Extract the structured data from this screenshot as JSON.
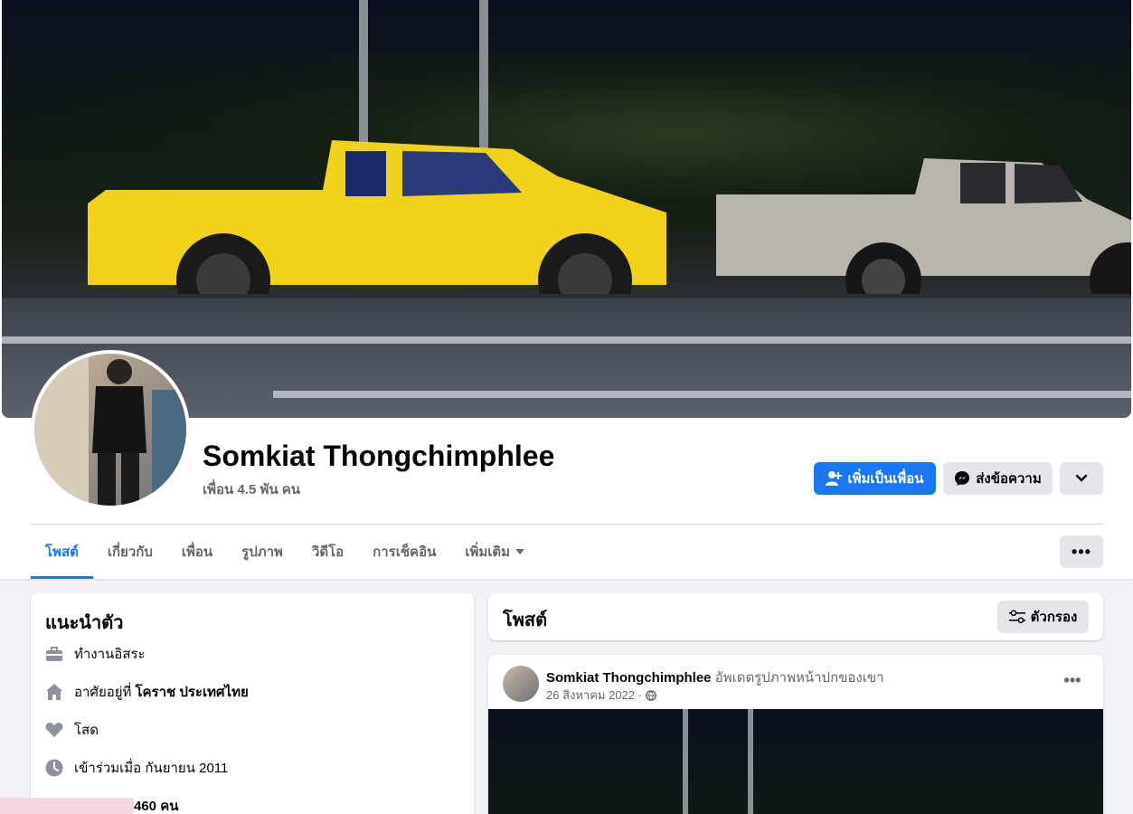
{
  "profile": {
    "name": "Somkiat Thongchimphlee",
    "friends": "เพื่อน 4.5 พัน คน"
  },
  "actions": {
    "add_friend": "เพิ่มเป็นเพื่อน",
    "message": "ส่งข้อความ"
  },
  "tabs": [
    {
      "label": "โพสต์",
      "active": true
    },
    {
      "label": "เกี่ยวกับ"
    },
    {
      "label": "เพื่อน"
    },
    {
      "label": "รูปภาพ"
    },
    {
      "label": "วิดีโอ"
    },
    {
      "label": "การเช็คอิน"
    },
    {
      "label": "เพิ่มเติม"
    }
  ],
  "intro": {
    "title": "แนะนำตัว",
    "work": "ทำงานอิสระ",
    "lives_prefix": "อาศัยอยู่ที่",
    "lives_place": "โคราช ประเทศไทย",
    "relationship": "โสด",
    "joined": "เข้าร่วมเมื่อ กันยายน 2011",
    "followers_count": "460 คน"
  },
  "posts": {
    "title": "โพสต์",
    "filter_label": "ตัวกรอง",
    "items": [
      {
        "author": "Somkiat Thongchimphlee",
        "action": "อัพเดตรูปภาพหน้าปกของเขา",
        "date": "26 สิงหาคม 2022 ·"
      }
    ]
  },
  "colors": {
    "accent": "#1877f2",
    "secondary_button": "#e4e6eb",
    "page_bg": "#f0f2f5"
  }
}
